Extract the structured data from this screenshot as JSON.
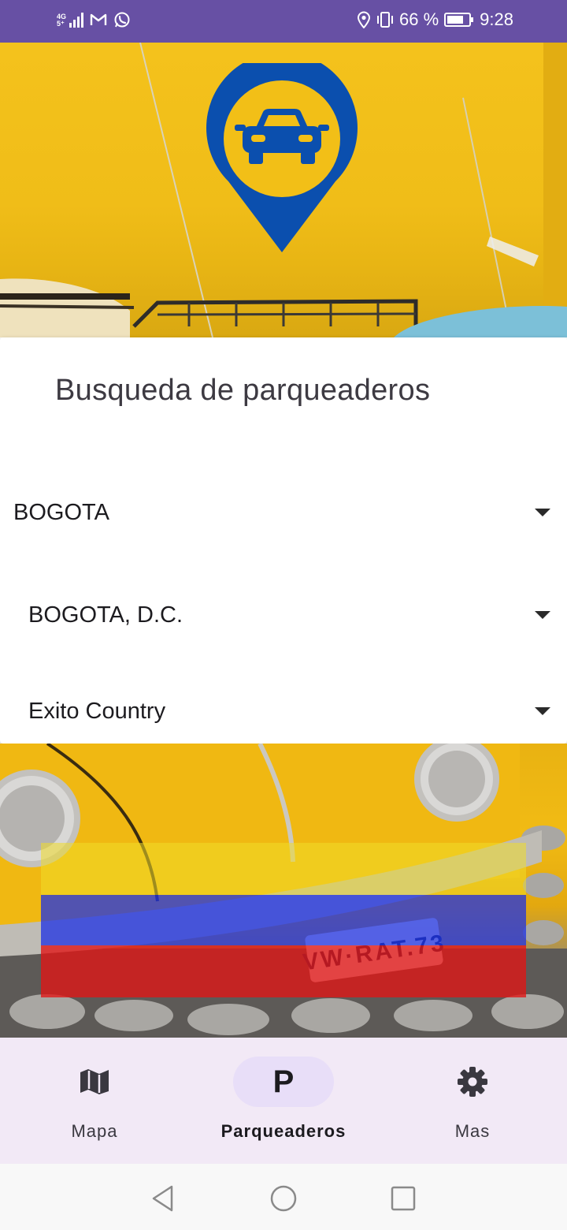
{
  "status_bar": {
    "network": "4G",
    "battery_percent": "66 %",
    "time": "9:28",
    "background_color": "#6750a4",
    "icons": [
      "signal-icon",
      "gmail-icon",
      "whatsapp-icon",
      "location-icon",
      "vibrate-icon",
      "battery-icon"
    ]
  },
  "search": {
    "title": "Busqueda de parqueaderos",
    "department": "BOGOTA",
    "city": "BOGOTA, D.C.",
    "parking": "Exito Country"
  },
  "bottom_nav": {
    "items": [
      {
        "label": "Mapa",
        "icon": "map-icon",
        "active": false
      },
      {
        "label": "Parqueaderos",
        "icon": "parking-icon",
        "active": true
      },
      {
        "label": "Mas",
        "icon": "gear-icon",
        "active": false
      }
    ],
    "parking_glyph": "P"
  },
  "system_nav": {
    "buttons": [
      "back-icon",
      "home-icon",
      "recents-icon"
    ]
  },
  "colors": {
    "accent": "#6750a4",
    "active_pill": "#e8def8",
    "nav_background": "#f2e9f6",
    "logo_blue": "#0b4fae",
    "background_yellow": "#f2bf17"
  }
}
